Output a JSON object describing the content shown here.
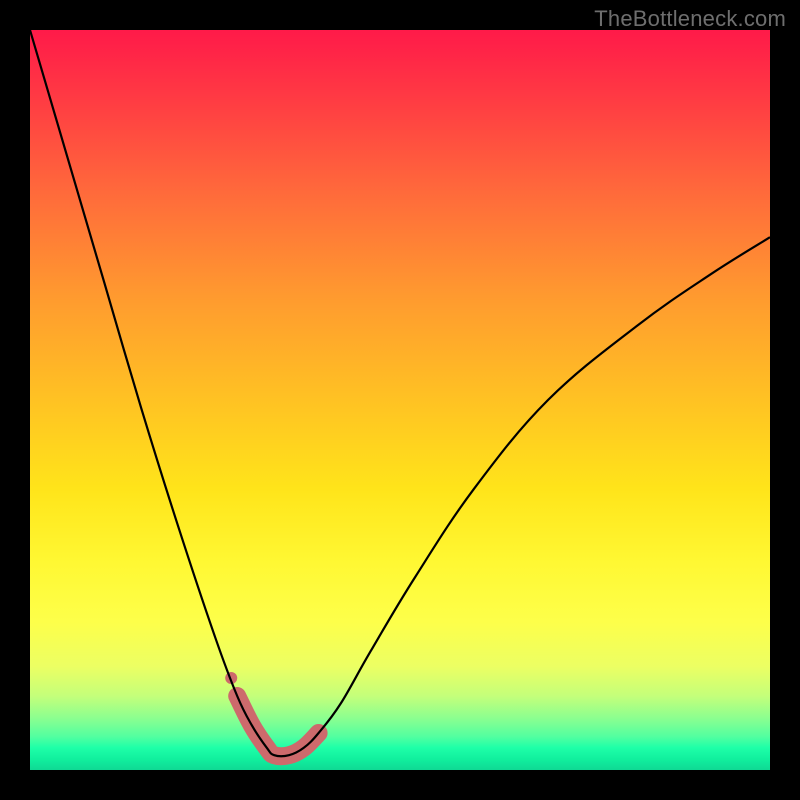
{
  "watermark": "TheBottleneck.com",
  "colors": {
    "frame": "#000000",
    "curve": "#000000",
    "band": "#cd6a6c"
  },
  "chart_data": {
    "type": "line",
    "title": "",
    "xlabel": "",
    "ylabel": "",
    "xlim": [
      0,
      100
    ],
    "ylim": [
      0,
      100
    ],
    "background_gradient": {
      "top": "#ff1a49",
      "mid": "#fff833",
      "bottom": "#0fd994",
      "meaning": "red=high bottleneck, green=low bottleneck"
    },
    "series": [
      {
        "name": "bottleneck-curve",
        "x": [
          0,
          5,
          10,
          15,
          20,
          25,
          28,
          30,
          32,
          33,
          35,
          37,
          39,
          42,
          46,
          52,
          60,
          70,
          82,
          92,
          100
        ],
        "y": [
          100,
          83,
          66,
          49,
          33,
          18,
          10,
          6,
          3,
          2,
          2,
          3,
          5,
          9,
          16,
          26,
          38,
          50,
          60,
          67,
          72
        ]
      }
    ],
    "highlight_band": {
      "name": "optimal-region",
      "color": "#cd6a6c",
      "x": [
        28,
        30,
        32,
        33,
        35,
        37,
        39
      ],
      "y": [
        10,
        6,
        3,
        2,
        2,
        3,
        5
      ]
    }
  }
}
